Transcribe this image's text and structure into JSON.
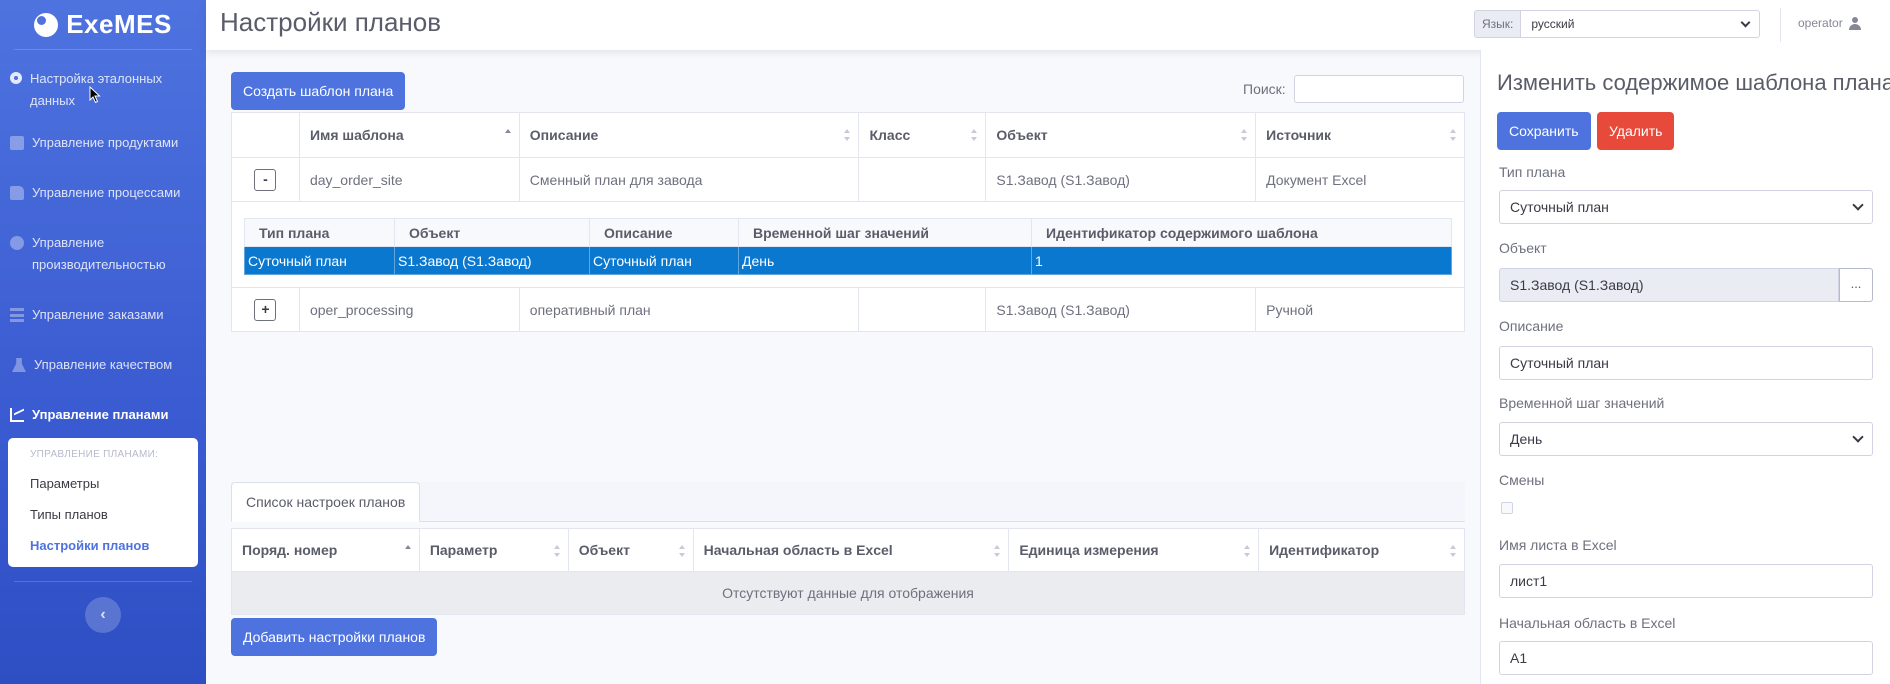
{
  "brand": {
    "name": "ExeMES"
  },
  "sidebar": {
    "items": [
      {
        "label": "Настройка эталонных данных",
        "icon": "gear-icon"
      },
      {
        "label": "Управление продуктами",
        "icon": "box-icon"
      },
      {
        "label": "Управление процессами",
        "icon": "truck-icon"
      },
      {
        "label": "Управление производительностью",
        "icon": "gauge-icon"
      },
      {
        "label": "Управление заказами",
        "icon": "list-icon"
      },
      {
        "label": "Управление качеством",
        "icon": "flask-icon"
      },
      {
        "label": "Управление планами",
        "icon": "chart-line-icon"
      }
    ],
    "submenu": {
      "header": "УПРАВЛЕНИЕ ПЛАНАМИ:",
      "items": [
        "Параметры",
        "Типы планов",
        "Настройки планов"
      ]
    },
    "toggle_icon": "chevron-left-icon"
  },
  "topbar": {
    "title": "Настройки планов",
    "lang_label": "Язык:",
    "lang_value": "русский",
    "user": "operator"
  },
  "main": {
    "create_label": "Создать шаблон плана",
    "search_label": "Поиск:",
    "search_value": "",
    "columns": [
      "Имя шаблона",
      "Описание",
      "Класс",
      "Объект",
      "Источник"
    ],
    "rows": [
      {
        "toggle": "-",
        "name": "day_order_site",
        "description": "Сменный план для завода",
        "class": "",
        "object": "S1.Завод (S1.Завод)",
        "source": "Документ Excel"
      },
      {
        "toggle": "+",
        "name": "oper_processing",
        "description": "оперативный план",
        "class": "",
        "object": "S1.Завод (S1.Завод)",
        "source": "Ручной"
      }
    ],
    "detail": {
      "columns": [
        "Тип плана",
        "Объект",
        "Описание",
        "Временной шаг значений",
        "Идентификатор содержимого шаблона"
      ],
      "row": [
        "Суточный план",
        "S1.Завод (S1.Завод)",
        "Суточный план",
        "День",
        "1"
      ]
    },
    "tab_label": "Список настроек планов",
    "columns2": [
      "Поряд. номер",
      "Параметр",
      "Объект",
      "Начальная область в Excel",
      "Единица измерения",
      "Идентификатор"
    ],
    "empty_text": "Отсутствуют данные для отображения",
    "add_label": "Добавить настройки планов"
  },
  "panel": {
    "title": "Изменить содержимое шаблона плана",
    "save_label": "Сохранить",
    "delete_label": "Удалить",
    "plan_type_label": "Тип плана",
    "plan_type_value": "Суточный план",
    "object_label": "Объект",
    "object_value": "S1.Завод (S1.Завод)",
    "object_button": "...",
    "description_label": "Описание",
    "description_value": "Суточный план",
    "time_step_label": "Временной шаг значений",
    "time_step_value": "День",
    "shifts_label": "Смены",
    "sheet_label": "Имя листа в Excel",
    "sheet_value": "лист1",
    "start_area_label": "Начальная область в Excel",
    "start_area_value": "A1"
  },
  "colors": {
    "primary": "#4e73df",
    "danger": "#e74a3b",
    "selected_row": "#0b78d0"
  }
}
